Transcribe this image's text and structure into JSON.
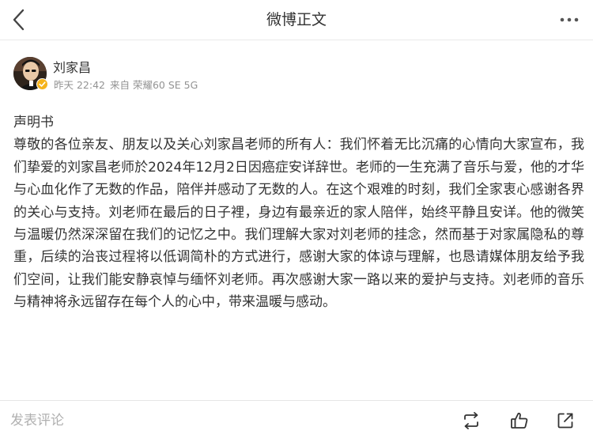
{
  "header": {
    "title": "微博正文",
    "back_icon": "chevron-left-icon",
    "more_icon": "more-horizontal-icon"
  },
  "author": {
    "name": "刘家昌",
    "time": "昨天 22:42",
    "source": "来自 荣耀60 SE 5G",
    "verified_badge_color": "#f5b31b"
  },
  "post": {
    "heading": "声明书",
    "body": "尊敬的各位亲友、朋友以及关心刘家昌老师的所有人：我们怀着无比沉痛的心情向大家宣布，我们挚爱的刘家昌老师於2024年12月2日因癌症安详辞世。老师的一生充满了音乐与爱，他的才华与心血化作了无数的作品，陪伴并感动了无数的人。在这个艰难的时刻，我们全家衷心感谢各界的关心与支持。刘老师在最后的日子裡，身边有最亲近的家人陪伴，始终平静且安详。他的微笑与温暖仍然深深留在我们的记忆之中。我们理解大家对刘老师的挂念，然而基于对家属隐私的尊重，后续的治丧过程将以低调简朴的方式进行，感谢大家的体谅与理解，也恳请媒体朋友给予我们空间，让我们能安静哀悼与缅怀刘老师。再次感谢大家一路以来的爱护与支持。刘老师的音乐与精神将永远留存在每个人的心中，带来温暖与感动。"
  },
  "footer": {
    "comment_placeholder": "发表评论",
    "actions": [
      "repost-icon",
      "like-icon",
      "share-icon"
    ]
  }
}
